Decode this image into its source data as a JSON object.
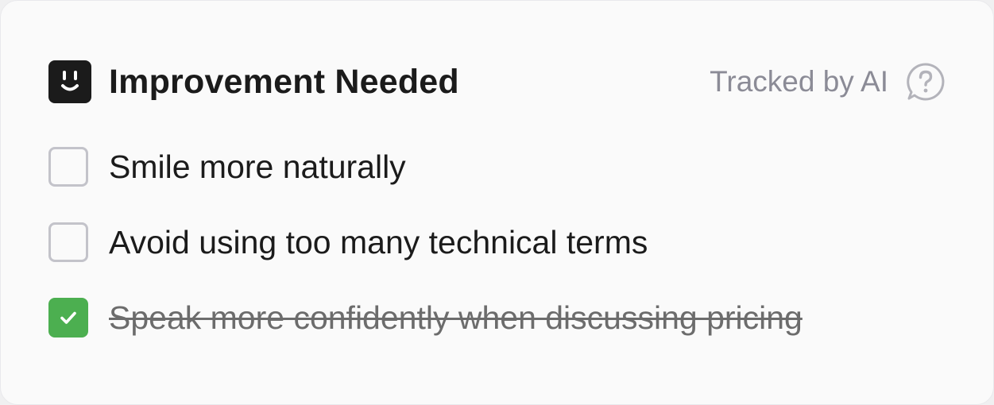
{
  "header": {
    "title": "Improvement Needed",
    "title_icon": "smile-face-icon",
    "tracked_label": "Tracked by AI",
    "help_icon": "question-chat-icon"
  },
  "items": [
    {
      "label": "Smile more naturally",
      "checked": false
    },
    {
      "label": "Avoid using too many technical terms",
      "checked": false
    },
    {
      "label": "Speak more confidently when discussing pricing",
      "checked": true
    }
  ],
  "colors": {
    "checked_green": "#4caf50",
    "icon_dark": "#1b1b1b",
    "muted_text": "#8b8b96"
  }
}
